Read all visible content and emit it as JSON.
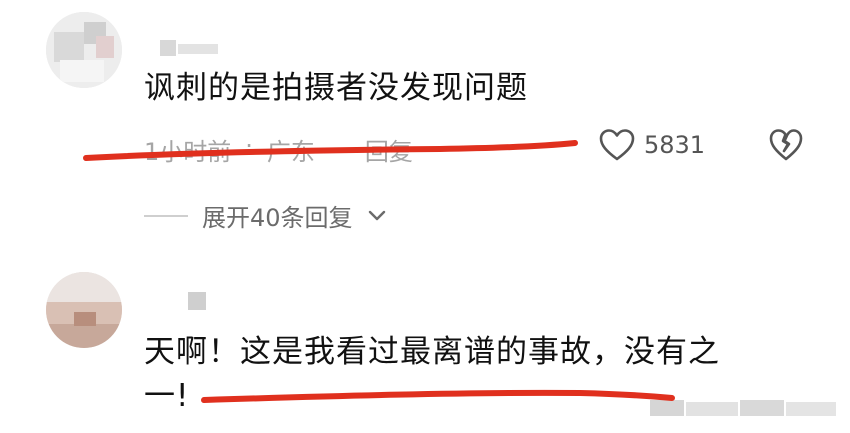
{
  "comments": [
    {
      "text": "讽刺的是拍摄者没发现问题",
      "time": "1小时前",
      "sep": "·",
      "location": "广东",
      "reply": "回复",
      "likes": "5831",
      "expand_replies": "展开40条回复"
    },
    {
      "text_line1": "天啊！这是我看过最离谱的事故，没有之",
      "text_line2": "一!"
    }
  ],
  "icons": {
    "like": "heart-outline-icon",
    "dislike": "broken-heart-icon",
    "expand": "chevron-down-icon"
  },
  "colors": {
    "underline": "#e0301e",
    "meta_text": "#a5a5a5"
  }
}
